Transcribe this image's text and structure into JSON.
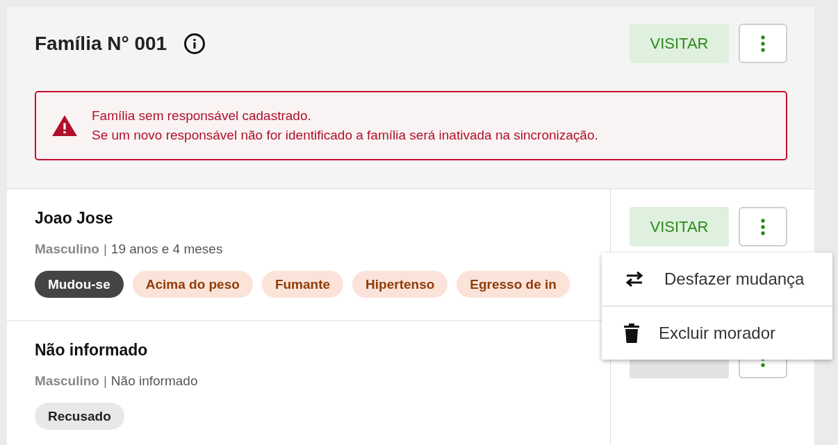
{
  "family": {
    "title": "Família N° 001",
    "visit_button": "VISITAR",
    "alert": {
      "lines": [
        "Família sem responsável cadastrado.",
        "Se um novo responsável não for identificado a família será inativada na sincronização."
      ]
    }
  },
  "residents": [
    {
      "name": "Joao Jose",
      "sex": "Masculino",
      "separator": "|",
      "age": "19 anos e 4 meses",
      "visit_button": {
        "label": "VISITAR",
        "disabled": false
      },
      "tags": [
        {
          "label": "Mudou-se",
          "kind": "status"
        },
        {
          "label": "Acima do peso",
          "kind": "condition"
        },
        {
          "label": "Fumante",
          "kind": "condition"
        },
        {
          "label": "Hipertenso",
          "kind": "condition"
        },
        {
          "label": "Egresso de in",
          "kind": "condition"
        }
      ]
    },
    {
      "name": "Não informado",
      "sex": "Masculino",
      "separator": "|",
      "age": "Não informado",
      "visit_button": {
        "disabled": true
      },
      "tags": [
        {
          "label": "Recusado",
          "kind": "neutral"
        }
      ]
    }
  ],
  "menu": {
    "items": [
      {
        "label": "Desfazer mudança",
        "kind": "swap"
      },
      {
        "label": "Excluir morador",
        "kind": "delete"
      }
    ]
  }
}
